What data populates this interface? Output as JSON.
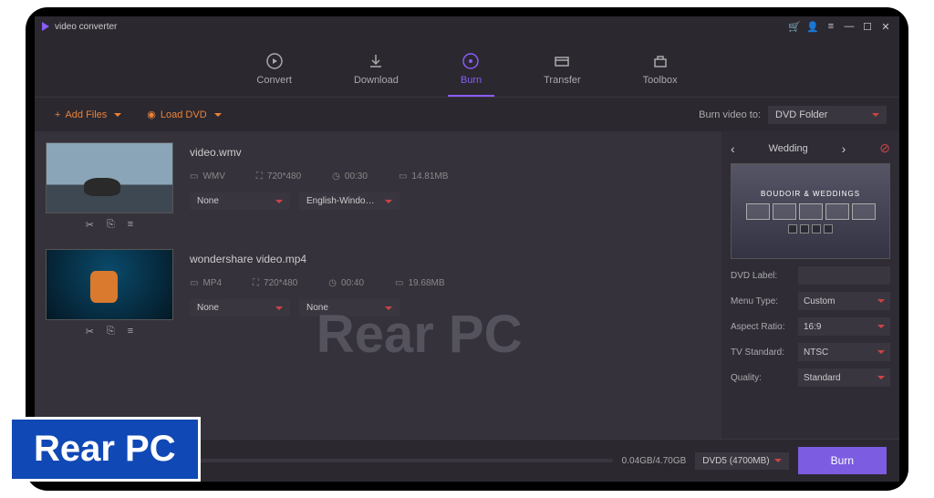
{
  "app": {
    "title": "video converter"
  },
  "nav": {
    "convert": "Convert",
    "download": "Download",
    "burn": "Burn",
    "transfer": "Transfer",
    "toolbox": "Toolbox"
  },
  "toolbar": {
    "add_files": "Add Files",
    "load_dvd": "Load DVD",
    "burn_to_label": "Burn video to:",
    "burn_to_value": "DVD Folder"
  },
  "items": [
    {
      "filename": "video.wmv",
      "format": "WMV",
      "resolution": "720*480",
      "duration": "00:30",
      "size": "14.81MB",
      "sub": "None",
      "audio": "English-Windo…"
    },
    {
      "filename": "wondershare video.mp4",
      "format": "MP4",
      "resolution": "720*480",
      "duration": "00:40",
      "size": "19.68MB",
      "sub": "None",
      "audio": "None"
    }
  ],
  "side": {
    "theme": "Wedding",
    "preview_banner": "BOUDOIR & WEDDINGS",
    "dvd_label_label": "DVD Label:",
    "dvd_label_value": "",
    "menu_type_label": "Menu Type:",
    "menu_type_value": "Custom",
    "aspect_label": "Aspect Ratio:",
    "aspect_value": "16:9",
    "tv_label": "TV Standard:",
    "tv_value": "NTSC",
    "quality_label": "Quality:",
    "quality_value": "Standard"
  },
  "footer": {
    "size": "0.04GB/4.70GB",
    "disc": "DVD5 (4700MB)",
    "burn": "Burn"
  },
  "watermark": "Rear PC",
  "badge": "Rear PC"
}
